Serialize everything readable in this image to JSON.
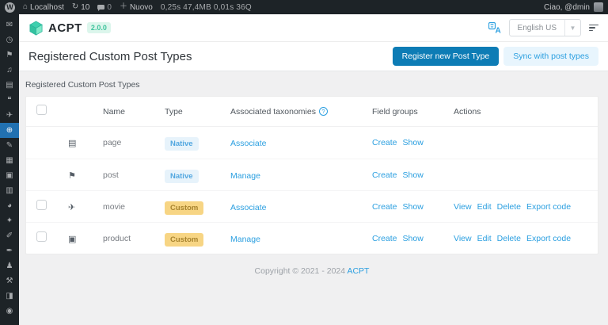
{
  "admin_bar": {
    "wp_logo": "W",
    "site_name": "Localhost",
    "updates_count": "10",
    "comments_count": "0",
    "new_label": "Nuovo",
    "stats": "0,25s 47,4MB 0,01s 36Q",
    "greeting": "Ciao, @dmin"
  },
  "sidebar": {
    "items": [
      {
        "name": "mail-icon",
        "glyph": "✉",
        "active": false
      },
      {
        "name": "dashboard-icon",
        "glyph": "◷",
        "active": false
      },
      {
        "name": "posts-pin-icon",
        "glyph": "⚑",
        "active": false
      },
      {
        "name": "media-icon",
        "glyph": "♫",
        "active": false
      },
      {
        "name": "pages-icon",
        "glyph": "▤",
        "active": false
      },
      {
        "name": "comments-icon",
        "glyph": "❝",
        "active": false
      },
      {
        "name": "plane-icon",
        "glyph": "✈",
        "active": false
      },
      {
        "name": "acpt-menu-icon",
        "glyph": "⊕",
        "active": true
      },
      {
        "name": "appearance-icon",
        "glyph": "✎",
        "active": false
      },
      {
        "name": "plugins-icon",
        "glyph": "▦",
        "active": false
      },
      {
        "name": "gallery-icon",
        "glyph": "▣",
        "active": false
      },
      {
        "name": "grid-icon",
        "glyph": "▥",
        "active": false
      },
      {
        "name": "pie-chart-icon",
        "glyph": "◕",
        "active": false
      },
      {
        "name": "bell-icon",
        "glyph": "✦",
        "active": false
      },
      {
        "name": "brush-icon",
        "glyph": "✐",
        "active": false
      },
      {
        "name": "pen-icon",
        "glyph": "✒",
        "active": false
      },
      {
        "name": "user-icon",
        "glyph": "♟",
        "active": false
      },
      {
        "name": "wrench-icon",
        "glyph": "⚒",
        "active": false
      },
      {
        "name": "box-icon",
        "glyph": "◨",
        "active": false
      },
      {
        "name": "video-icon",
        "glyph": "◉",
        "active": false
      }
    ]
  },
  "header": {
    "app_name": "ACPT",
    "version": "2.0.0",
    "language_selected": "English US"
  },
  "page": {
    "title": "Registered Custom Post Types",
    "register_button": "Register new Post Type",
    "sync_button": "Sync with post types",
    "section_label": "Registered Custom Post Types"
  },
  "table": {
    "headers": {
      "name": "Name",
      "type": "Type",
      "taxonomies": "Associated taxonomies",
      "help_icon": "?",
      "field_groups": "Field groups",
      "actions": "Actions"
    },
    "rows": [
      {
        "icon": "pages-icon",
        "icon_glyph": "▤",
        "name": "page",
        "type": "Native",
        "taxonomy_action": "Associate",
        "field_group_actions": [
          "Create",
          "Show"
        ],
        "actions": [],
        "has_checkbox": false
      },
      {
        "icon": "pin-icon",
        "icon_glyph": "⚑",
        "name": "post",
        "type": "Native",
        "taxonomy_action": "Manage",
        "field_group_actions": [
          "Create",
          "Show"
        ],
        "actions": [],
        "has_checkbox": false
      },
      {
        "icon": "plane-icon",
        "icon_glyph": "✈",
        "name": "movie",
        "type": "Custom",
        "taxonomy_action": "Associate",
        "field_group_actions": [
          "Create",
          "Show"
        ],
        "actions": [
          "View",
          "Edit",
          "Delete",
          "Export code"
        ],
        "has_checkbox": true
      },
      {
        "icon": "product-icon",
        "icon_glyph": "▣",
        "name": "product",
        "type": "Custom",
        "taxonomy_action": "Manage",
        "field_group_actions": [
          "Create",
          "Show"
        ],
        "actions": [
          "View",
          "Edit",
          "Delete",
          "Export code"
        ],
        "has_checkbox": true
      }
    ]
  },
  "footer": {
    "copyright": "Copyright © 2021 - 2024",
    "link_label": "ACPT"
  },
  "colors": {
    "accent_blue": "#2b9fe0",
    "primary_button": "#0d7cb5",
    "sidebar_active": "#2271b1",
    "admin_bar_bg": "#1d2327",
    "custom_badge_bg": "#f7d584",
    "native_badge_bg": "#e7f3fb",
    "version_badge": "#3fc39c"
  }
}
